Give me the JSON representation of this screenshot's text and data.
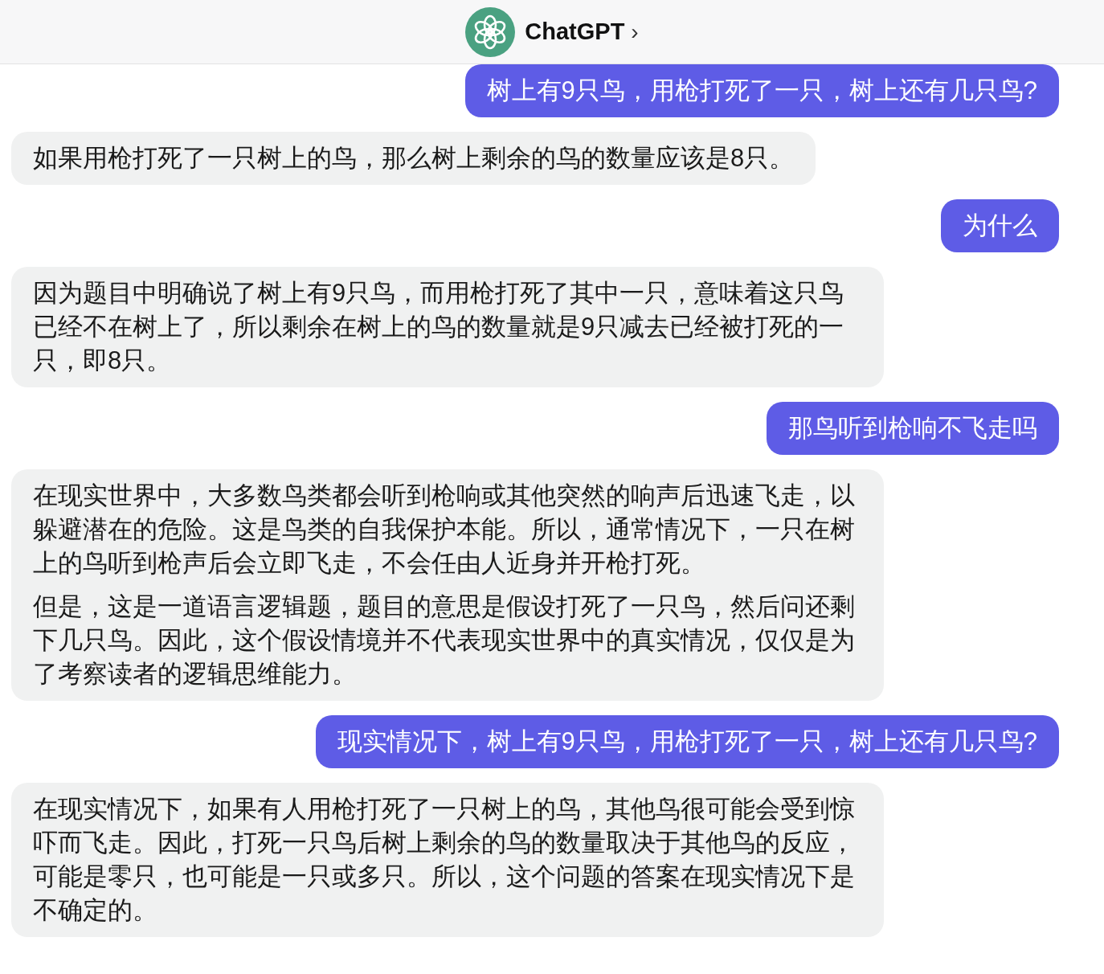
{
  "header": {
    "title": "ChatGPT",
    "chevron": "›"
  },
  "messages": [
    {
      "kind": "user",
      "paragraphs": [
        "树上有9只鸟，用枪打死了一只，树上还有几只鸟?"
      ]
    },
    {
      "kind": "assistant",
      "paragraphs": [
        "如果用枪打死了一只树上的鸟，那么树上剩余的鸟的数量应该是8只。"
      ]
    },
    {
      "kind": "user",
      "paragraphs": [
        "为什么"
      ]
    },
    {
      "kind": "assistant",
      "paragraphs": [
        "因为题目中明确说了树上有9只鸟，而用枪打死了其中一只，意味着这只鸟已经不在树上了，所以剩余在树上的鸟的数量就是9只减去已经被打死的一只，即8只。"
      ]
    },
    {
      "kind": "user",
      "paragraphs": [
        "那鸟听到枪响不飞走吗"
      ]
    },
    {
      "kind": "assistant",
      "paragraphs": [
        "在现实世界中，大多数鸟类都会听到枪响或其他突然的响声后迅速飞走，以躲避潜在的危险。这是鸟类的自我保护本能。所以，通常情况下，一只在树上的鸟听到枪声后会立即飞走，不会任由人近身并开枪打死。",
        "但是，这是一道语言逻辑题，题目的意思是假设打死了一只鸟，然后问还剩下几只鸟。因此，这个假设情境并不代表现实世界中的真实情况，仅仅是为了考察读者的逻辑思维能力。"
      ]
    },
    {
      "kind": "user",
      "paragraphs": [
        "现实情况下，树上有9只鸟，用枪打死了一只，树上还有几只鸟?"
      ]
    },
    {
      "kind": "assistant",
      "paragraphs": [
        "在现实情况下，如果有人用枪打死了一只树上的鸟，其他鸟很可能会受到惊吓而飞走。因此，打死一只鸟后树上剩余的鸟的数量取决于其他鸟的反应，可能是零只，也可能是一只或多只。所以，这个问题的答案在现实情况下是不确定的。"
      ]
    }
  ]
}
